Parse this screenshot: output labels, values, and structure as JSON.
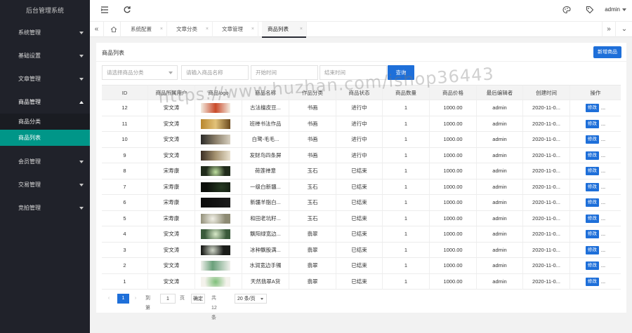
{
  "sidebar": {
    "title": "后台管理系统",
    "menus": [
      {
        "label": "系统管理",
        "open": false
      },
      {
        "label": "基础设置",
        "open": false
      },
      {
        "label": "文章管理",
        "open": false
      },
      {
        "label": "商品管理",
        "open": true
      },
      {
        "label": "会员管理",
        "open": false
      },
      {
        "label": "交易管理",
        "open": false
      },
      {
        "label": "竞拍管理",
        "open": false
      }
    ],
    "submenu": [
      {
        "label": "商品分类",
        "active": false
      },
      {
        "label": "商品列表",
        "active": true
      }
    ]
  },
  "header": {
    "user": "admin",
    "icons": [
      "menu-fold-icon",
      "refresh-icon",
      "theme-icon",
      "tag-icon"
    ]
  },
  "tabs": [
    {
      "label": "系统配置",
      "active": false
    },
    {
      "label": "文章分类",
      "active": false
    },
    {
      "label": "文章管理",
      "active": false
    },
    {
      "label": "商品列表",
      "active": true
    }
  ],
  "main": {
    "title": "商品列表",
    "new_button": "新增商品",
    "filters": {
      "category_placeholder": "请选择商品分类",
      "name_placeholder": "请输入商品名称",
      "start_placeholder": "开始时间",
      "end_placeholder": "结束时间",
      "query_label": "查询"
    },
    "table": {
      "columns": [
        "ID",
        "商品所属用户",
        "商品logo",
        "商品名称",
        "作品分类",
        "商品状态",
        "商品数量",
        "商品价格",
        "最后编辑者",
        "创建时间",
        "操作"
      ],
      "edit_label": "修改",
      "more_label": "...",
      "rows": [
        {
          "id": "12",
          "user": "安文涛",
          "name": "古法檀皮豆...",
          "category": "书画",
          "status": "进行中",
          "qty": "1",
          "price": "1000.00",
          "editor": "admin",
          "created": "2020-11-0..."
        },
        {
          "id": "11",
          "user": "安文涛",
          "name": "班禅书法作品",
          "category": "书画",
          "status": "进行中",
          "qty": "1",
          "price": "1000.00",
          "editor": "admin",
          "created": "2020-11-0..."
        },
        {
          "id": "10",
          "user": "安文涛",
          "name": "白鹭-毛毛...",
          "category": "书画",
          "status": "进行中",
          "qty": "1",
          "price": "1000.00",
          "editor": "admin",
          "created": "2020-11-0..."
        },
        {
          "id": "9",
          "user": "安文涛",
          "name": "发财鸟四条屏",
          "category": "书画",
          "status": "进行中",
          "qty": "1",
          "price": "1000.00",
          "editor": "admin",
          "created": "2020-11-0..."
        },
        {
          "id": "8",
          "user": "宋寿康",
          "name": "荷莲禅意",
          "category": "玉石",
          "status": "已结束",
          "qty": "1",
          "price": "1000.00",
          "editor": "admin",
          "created": "2020-11-0..."
        },
        {
          "id": "7",
          "user": "宋寿康",
          "name": "一级白新疆...",
          "category": "玉石",
          "status": "已结束",
          "qty": "1",
          "price": "1000.00",
          "editor": "admin",
          "created": "2020-11-0..."
        },
        {
          "id": "6",
          "user": "宋寿康",
          "name": "新疆羊脂白...",
          "category": "玉石",
          "status": "已结束",
          "qty": "1",
          "price": "1000.00",
          "editor": "admin",
          "created": "2020-11-0..."
        },
        {
          "id": "5",
          "user": "宋寿康",
          "name": "和田老坑籽...",
          "category": "玉石",
          "status": "已结束",
          "qty": "1",
          "price": "1000.00",
          "editor": "admin",
          "created": "2020-11-0..."
        },
        {
          "id": "4",
          "user": "安文涛",
          "name": "飘阳绿宽边...",
          "category": "翡翠",
          "status": "已结束",
          "qty": "1",
          "price": "1000.00",
          "editor": "admin",
          "created": "2020-11-0..."
        },
        {
          "id": "3",
          "user": "安文涛",
          "name": "冰种飘股满...",
          "category": "翡翠",
          "status": "已结束",
          "qty": "1",
          "price": "1000.00",
          "editor": "admin",
          "created": "2020-11-0..."
        },
        {
          "id": "2",
          "user": "安文涛",
          "name": "水润宽边手镯",
          "category": "翡翠",
          "status": "已结束",
          "qty": "1",
          "price": "1000.00",
          "editor": "admin",
          "created": "2020-11-0..."
        },
        {
          "id": "1",
          "user": "安文涛",
          "name": "天然翡翠A货",
          "category": "翡翠",
          "status": "已结束",
          "qty": "1",
          "price": "1000.00",
          "editor": "admin",
          "created": "2020-11-0..."
        }
      ]
    },
    "pagination": {
      "current": "1",
      "goto_label": "到第",
      "goto_value": "1",
      "page_unit": "页",
      "confirm_label": "确定",
      "total": "共 12 条",
      "page_size": "20 条/页"
    }
  },
  "watermark": "https://www.huzhan.com/ishop36443",
  "colors": {
    "sidebar": "#20222a",
    "active_menu": "#009688",
    "primary": "#1e6fd9"
  }
}
